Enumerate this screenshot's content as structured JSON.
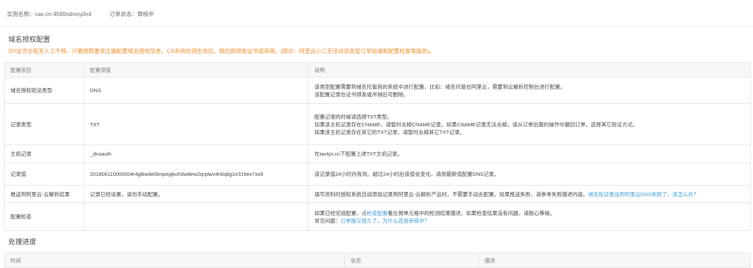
{
  "top": {
    "instance_label": "实例名称：",
    "instance_value": "cas-cn-4590ndmsy0n4",
    "status_label": "订单状态：",
    "status_value": "审核中"
  },
  "domain_config": {
    "title": "域名授权配置",
    "warning": "DV证书全程无人工干预，只要按照要求正确配置域名授权信息，CA系统检测生效后，随后即颁发证书或吊销。(提示：阿里云小二无法对该类型订单加速和配置检查等服务)。",
    "headers": [
      "配置项目",
      "配置项值",
      "说明"
    ],
    "rows": [
      {
        "item": "域名授权验证类型",
        "value": "DNS",
        "desc": [
          "该类型配置需要到域名托管商的系统中进行配置，比如：域名托管在阿里云，需要到云解析控制台进行配置。",
          "该配置记录在证书颁发或吊销后可删除。"
        ]
      },
      {
        "item": "记录类型",
        "value": "TXT",
        "desc": [
          "配置记录的时候请选择TXT类型。",
          "如果该主机记录存在CNAME，请暂时去掉CNAME记录。如果CNAME记录无法去掉，请从订单后面的操作中撤回订单，选择其它验证方式。",
          "如果该主机记录存在其它的TXT记录，请暂时去掉其它TXT记录。"
        ]
      },
      {
        "item": "主机记录",
        "value": "_dnsauth",
        "desc": [
          "在tavtyx.cn下配置上述TXT主机记录。"
        ]
      },
      {
        "item": "记录值",
        "value": "201806110000004r4glkwde0knpepjkoh3w8ew2qrplwv4n6qlig1e31ttex7xx9",
        "desc": [
          "该记录值24小时内有效。超过24小时后该值会变化，请用最新值配置DNS记录。"
        ]
      },
      {
        "item": "推送到阿里云-云解析结果",
        "value": "记录已经设置，请勿手动配置。",
        "desc_prefix": "填写资料时授权系统自动添加记录到阿里云-云解析产品时，不需要手动去配置。如果推送失败，请参考失败描述内容。",
        "desc_link": "域名验证推送到阿里云DNS失败了，该怎么办？"
      },
      {
        "item": "配置检查",
        "value": "",
        "desc_line1_prefix": "如果已经完成配置，点",
        "desc_line1_link": "检查配置",
        "desc_line1_suffix": "看左侧单元格中的检测结果描述。如果检查结果没有问题，请耐心等候。",
        "desc_line2_prefix": "常见问题：",
        "desc_line2_link": "订单提交很久了，为什么还是审核中？"
      }
    ]
  },
  "progress": {
    "title": "处理进度",
    "headers": [
      "时间",
      "状态",
      "描述"
    ]
  },
  "colors": {
    "warning": "#f08c2b",
    "red": "#e0453a",
    "link": "#3b9ad9",
    "header_bg": "#f7f7f7",
    "border": "#e6e6e6"
  }
}
